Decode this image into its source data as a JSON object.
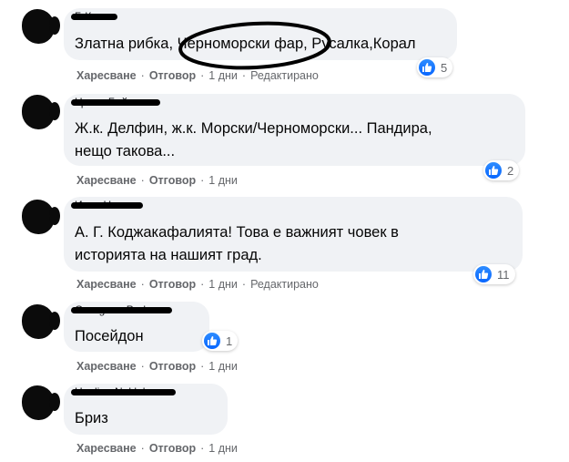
{
  "labels": {
    "like": "Харесване",
    "reply": "Отговор",
    "edited": "Редактирано",
    "dot": "·"
  },
  "comments": [
    {
      "author": "Б.Ксич",
      "text_lines": [
        "Златна рибка, Черноморски фар, Русалка,Корал"
      ],
      "reactions": "5",
      "time": "1 дни",
      "edited": true
    },
    {
      "author": "Цвети Байчева",
      "text_lines": [
        "Ж.к. Делфин, ж.к. Морски/Черноморски... Пандира,",
        "нещо такова..."
      ],
      "reactions": "2",
      "time": "1 дни",
      "edited": false
    },
    {
      "author": "Иван Неков",
      "text_lines": [
        "А. Г. Коджакафалията! Това е важният човек в",
        "историята на нашият град."
      ],
      "reactions": "11",
      "time": "1 дни",
      "edited": true
    },
    {
      "author": "Gaergana Parlova",
      "text_lines": [
        "Посейдон"
      ],
      "reactions": "1",
      "time": "1 дни",
      "edited": false
    },
    {
      "author": "Haalina Nekleheva",
      "text_lines": [
        "Бриз"
      ],
      "reactions": "",
      "time": "1 дни",
      "edited": false
    }
  ],
  "colors": {
    "bubble": "#f0f2f5",
    "like_blue": "#0866ff",
    "meta_gray": "#65676b"
  }
}
